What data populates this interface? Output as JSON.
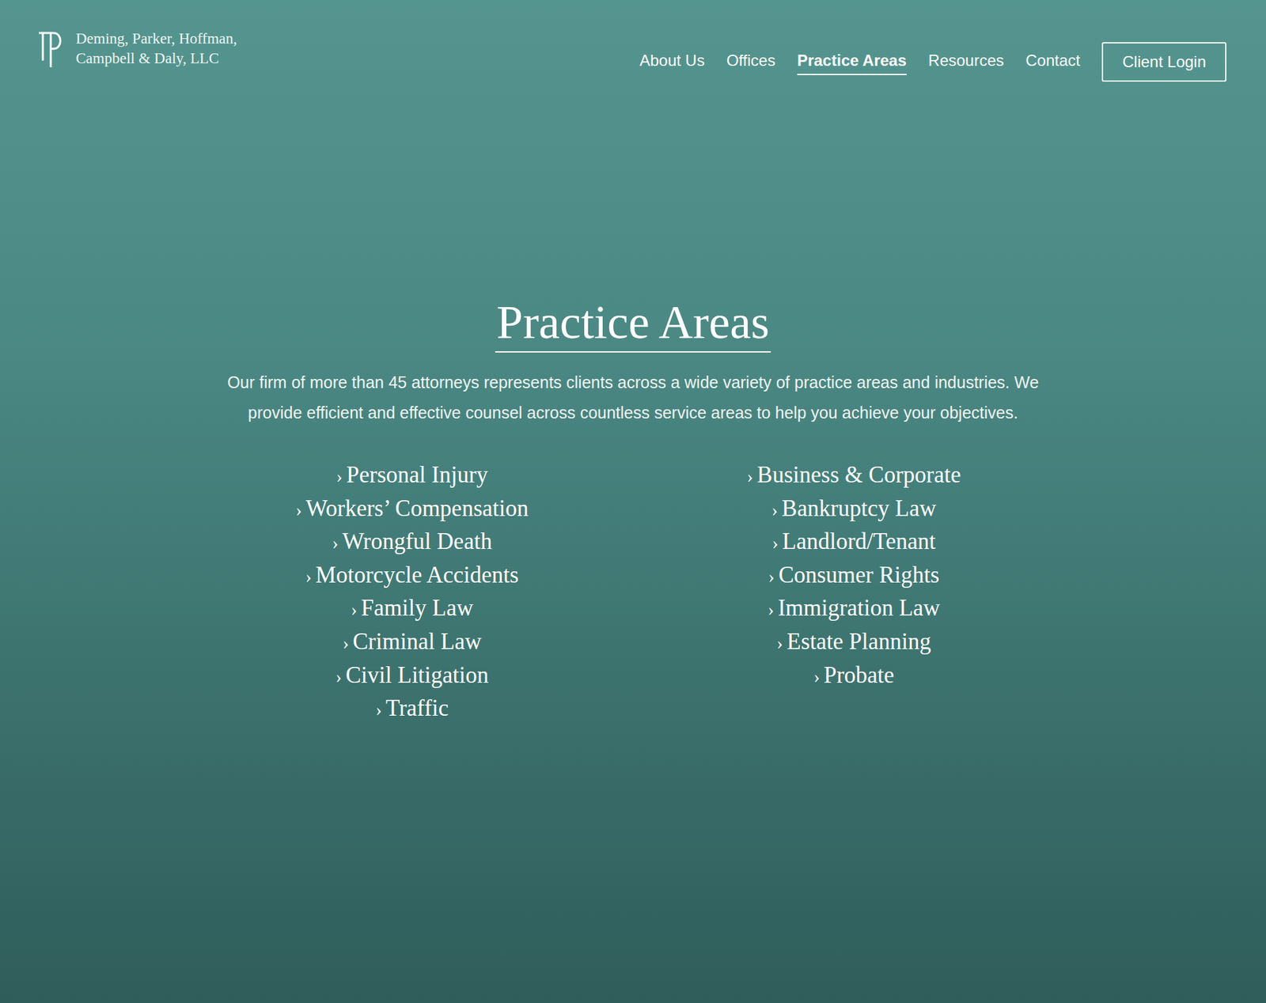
{
  "header": {
    "logo": {
      "name_lines": [
        "Deming, Parker, Hoffman,",
        "Campbell & Daly, LLC"
      ]
    },
    "nav": [
      {
        "label": "About Us",
        "selected": false
      },
      {
        "label": "Offices",
        "selected": false
      },
      {
        "label": "Practice Areas",
        "selected": true
      },
      {
        "label": "Resources",
        "selected": false
      },
      {
        "label": "Contact",
        "selected": false
      }
    ],
    "login_button": "Client Login"
  },
  "hero": {
    "title": "Practice Areas",
    "description": "Our firm of more than 45 attorneys represents clients across a wide variety of practice areas and industries. We provide efficient and effective counsel across countless service areas to help you achieve your objectives.",
    "marker": "›",
    "columns": [
      [
        "Personal Injury",
        "Workers’ Compensation",
        "Wrongful Death",
        "Motorcycle Accidents",
        "Family Law",
        "Criminal Law",
        "Civil Litigation",
        "Traffic"
      ],
      [
        "Business & Corporate",
        "Bankruptcy Law",
        "Landlord/Tenant",
        "Consumer Rights",
        "Immigration Law",
        "Estate Planning",
        "Probate"
      ]
    ]
  }
}
